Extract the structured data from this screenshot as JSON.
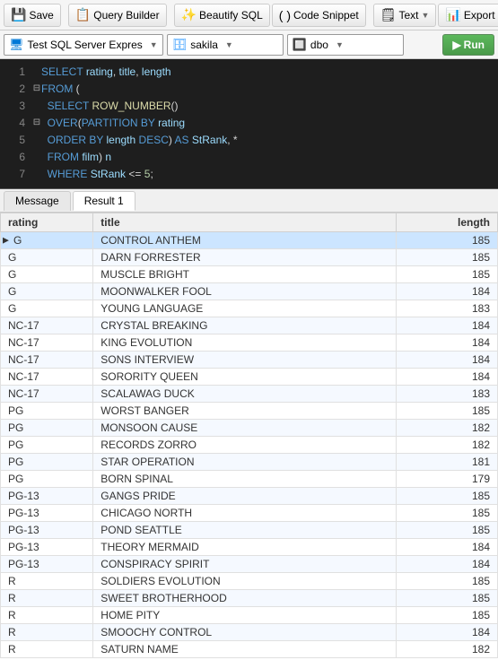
{
  "toolbar": {
    "save_label": "Save",
    "query_builder_label": "Query Builder",
    "beautify_sql_label": "Beautify SQL",
    "code_snippet_label": "Code Snippet",
    "text_label": "Text",
    "export_result_label": "Export Result"
  },
  "dbbar": {
    "server_label": "Test SQL Server Expres",
    "database_label": "sakila",
    "schema_label": "dbo",
    "run_label": "Run"
  },
  "sql": {
    "lines": [
      {
        "num": 1,
        "indicator": "",
        "content": "SELECT rating, title, length",
        "type": "select"
      },
      {
        "num": 2,
        "indicator": "⊟",
        "content": "FROM (",
        "type": "from"
      },
      {
        "num": 3,
        "indicator": "",
        "content": "  SELECT ROW_NUMBER()",
        "type": "select"
      },
      {
        "num": 4,
        "indicator": "⊟",
        "content": "  OVER(PARTITION BY rating",
        "type": "over"
      },
      {
        "num": 5,
        "indicator": "",
        "content": "  ORDER BY length DESC) AS StRank, *",
        "type": "order"
      },
      {
        "num": 6,
        "indicator": "",
        "content": "  FROM film) n",
        "type": "from2"
      },
      {
        "num": 7,
        "indicator": "",
        "content": "  WHERE StRank <= 5;",
        "type": "where"
      }
    ]
  },
  "tabs": {
    "message_label": "Message",
    "result1_label": "Result 1"
  },
  "results": {
    "columns": [
      "rating",
      "title",
      "length"
    ],
    "rows": [
      {
        "rating": "G",
        "title": "CONTROL ANTHEM",
        "length": 185,
        "selected": true
      },
      {
        "rating": "G",
        "title": "DARN FORRESTER",
        "length": 185
      },
      {
        "rating": "G",
        "title": "MUSCLE BRIGHT",
        "length": 185
      },
      {
        "rating": "G",
        "title": "MOONWALKER FOOL",
        "length": 184
      },
      {
        "rating": "G",
        "title": "YOUNG LANGUAGE",
        "length": 183
      },
      {
        "rating": "NC-17",
        "title": "CRYSTAL BREAKING",
        "length": 184
      },
      {
        "rating": "NC-17",
        "title": "KING EVOLUTION",
        "length": 184
      },
      {
        "rating": "NC-17",
        "title": "SONS INTERVIEW",
        "length": 184
      },
      {
        "rating": "NC-17",
        "title": "SORORITY QUEEN",
        "length": 184
      },
      {
        "rating": "NC-17",
        "title": "SCALAWAG DUCK",
        "length": 183
      },
      {
        "rating": "PG",
        "title": "WORST BANGER",
        "length": 185
      },
      {
        "rating": "PG",
        "title": "MONSOON CAUSE",
        "length": 182
      },
      {
        "rating": "PG",
        "title": "RECORDS ZORRO",
        "length": 182
      },
      {
        "rating": "PG",
        "title": "STAR OPERATION",
        "length": 181
      },
      {
        "rating": "PG",
        "title": "BORN SPINAL",
        "length": 179
      },
      {
        "rating": "PG-13",
        "title": "GANGS PRIDE",
        "length": 185
      },
      {
        "rating": "PG-13",
        "title": "CHICAGO NORTH",
        "length": 185
      },
      {
        "rating": "PG-13",
        "title": "POND SEATTLE",
        "length": 185
      },
      {
        "rating": "PG-13",
        "title": "THEORY MERMAID",
        "length": 184
      },
      {
        "rating": "PG-13",
        "title": "CONSPIRACY SPIRIT",
        "length": 184
      },
      {
        "rating": "R",
        "title": "SOLDIERS EVOLUTION",
        "length": 185
      },
      {
        "rating": "R",
        "title": "SWEET BROTHERHOOD",
        "length": 185
      },
      {
        "rating": "R",
        "title": "HOME PITY",
        "length": 185
      },
      {
        "rating": "R",
        "title": "SMOOCHY CONTROL",
        "length": 184
      },
      {
        "rating": "R",
        "title": "SATURN NAME",
        "length": 182
      }
    ]
  }
}
